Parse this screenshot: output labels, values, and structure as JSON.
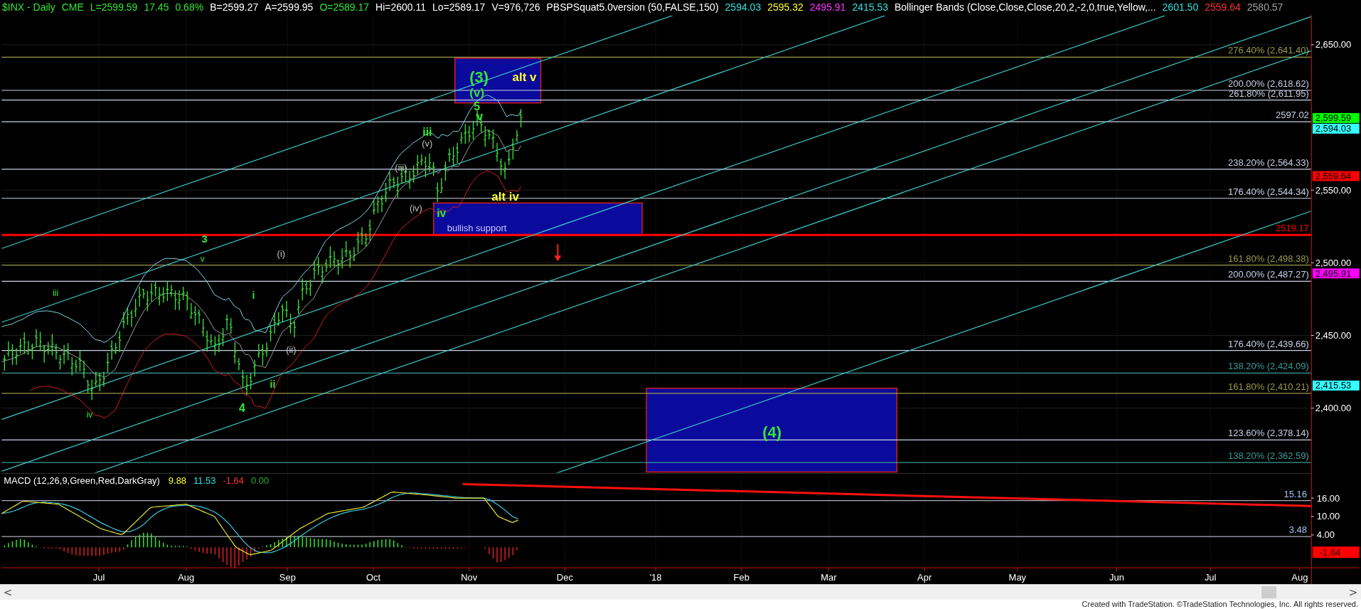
{
  "header": [
    {
      "text": "$INX - Daily",
      "color": "#33e633"
    },
    {
      "text": "CME",
      "color": "#33e633"
    },
    {
      "text": "L=2599.59",
      "color": "#33e633"
    },
    {
      "text": "17.45",
      "color": "#33e633"
    },
    {
      "text": "0.68%",
      "color": "#33e633"
    },
    {
      "text": "B=2599.27",
      "color": "#ffffff"
    },
    {
      "text": "A=2599.95",
      "color": "#ffffff"
    },
    {
      "text": "O=2589.17",
      "color": "#33e633"
    },
    {
      "text": "Hi=2600.11",
      "color": "#ffffff"
    },
    {
      "text": "Lo=2589.17",
      "color": "#ffffff"
    },
    {
      "text": "V=976,726",
      "color": "#ffffff"
    },
    {
      "text": "PBSPSquat5.0version (50,FALSE,150)",
      "color": "#ffffff"
    },
    {
      "text": "2594.03",
      "color": "#33e0e0"
    },
    {
      "text": "2595.32",
      "color": "#ffff33"
    },
    {
      "text": "2495.91",
      "color": "#ff33ff"
    },
    {
      "text": "2415.53",
      "color": "#33e0e0"
    },
    {
      "text": "Bollinger Bands (Close,Close,Close,20,2,-2,0,true,Yellow,...",
      "color": "#ffffff"
    },
    {
      "text": "2601.50",
      "color": "#33e0e0"
    },
    {
      "text": "2559.64",
      "color": "#ff3333"
    },
    {
      "text": "2580.57",
      "color": "#a0a0a0"
    }
  ],
  "price_axis": {
    "ticks": [
      "2,650.00",
      "2,550.00",
      "2,500.00",
      "2,450.00",
      "2,400.00"
    ],
    "badges": [
      {
        "text": "2,599.59",
        "color": "#00ff00"
      },
      {
        "text": "2,594.03",
        "color": "#33ffff"
      },
      {
        "text": "2,559.64",
        "color": "#ff0000"
      },
      {
        "text": "2,495.91",
        "color": "#ff00ff"
      },
      {
        "text": "2,415.53",
        "color": "#33ffff"
      }
    ]
  },
  "levels": [
    {
      "label": "276.40% (2,641.40)",
      "color": "#9c9a4a",
      "kind": "fib"
    },
    {
      "label": "200.00% (2,618.62)",
      "color": "#c8d2e6",
      "kind": "fib"
    },
    {
      "label": "261.80% (2,611.95)",
      "color": "#c8d2e6",
      "kind": "fib"
    },
    {
      "label": "2597.02",
      "color": "#c8d2e6",
      "kind": "price"
    },
    {
      "label": "238.20% (2,564.33)",
      "color": "#c8d2e6",
      "kind": "fib"
    },
    {
      "label": "176.40% (2,544.34)",
      "color": "#c8d2e6",
      "kind": "fib"
    },
    {
      "label": "2519.17",
      "color": "#ff0000",
      "kind": "support"
    },
    {
      "label": "161.80% (2,498.38)",
      "color": "#9c9a4a",
      "kind": "fib"
    },
    {
      "label": "200.00% (2,487.27)",
      "color": "#c8d2e6",
      "kind": "fib"
    },
    {
      "label": "176.40% (2,439.66)",
      "color": "#c8d2e6",
      "kind": "fib"
    },
    {
      "label": "138.20% (2,424.09)",
      "color": "#3c9a96",
      "kind": "fib"
    },
    {
      "label": "161.80% (2,410.21)",
      "color": "#9c9a4a",
      "kind": "fib"
    },
    {
      "label": "123.60% (2,378.14)",
      "color": "#c8d2e6",
      "kind": "fib"
    },
    {
      "label": "138.20% (2,362.59)",
      "color": "#3c9a96",
      "kind": "fib"
    }
  ],
  "wave_labels": [
    {
      "text": "(3)",
      "color": "#33e633"
    },
    {
      "text": "(v)",
      "color": "#33e633"
    },
    {
      "text": "5",
      "color": "#33e633"
    },
    {
      "text": "v",
      "color": "#33e633"
    },
    {
      "text": "alt v",
      "color": "#ffff33"
    },
    {
      "text": "iii",
      "color": "#33e633"
    },
    {
      "text": "(v)",
      "color": "#c0c0c0"
    },
    {
      "text": "(iii)",
      "color": "#c0c0c0"
    },
    {
      "text": "(iv)",
      "color": "#c0c0c0"
    },
    {
      "text": "iv",
      "color": "#33e633"
    },
    {
      "text": "alt iv",
      "color": "#ffff33"
    },
    {
      "text": "3",
      "color": "#33e633"
    },
    {
      "text": "v",
      "color": "#33e633"
    },
    {
      "text": "iii",
      "color": "#33e633"
    },
    {
      "text": "(i)",
      "color": "#c0c0c0"
    },
    {
      "text": "i",
      "color": "#33e633"
    },
    {
      "text": "(ii)",
      "color": "#c0c0c0"
    },
    {
      "text": "ii",
      "color": "#33e633"
    },
    {
      "text": "4",
      "color": "#33e633"
    },
    {
      "text": "iv",
      "color": "#33e633"
    },
    {
      "text": "(4)",
      "color": "#33e633"
    }
  ],
  "support_zone": {
    "label": "bullish support"
  },
  "macd": {
    "title": "MACD (12,26,9,Green,Red,DarkGray)",
    "readings": [
      {
        "text": "9.88",
        "color": "#ffff33"
      },
      {
        "text": "11.53",
        "color": "#33e0e0"
      },
      {
        "text": "-1.64",
        "color": "#ff3333"
      },
      {
        "text": "0.00",
        "color": "#33aa33"
      }
    ],
    "levels": [
      "15.16",
      "3.48"
    ],
    "axis_ticks": [
      "16.00",
      "10.00",
      "4.00"
    ],
    "badge": {
      "text": "-1.64",
      "color": "#ff0000"
    }
  },
  "date_axis": [
    "Jul",
    "Aug",
    "Sep",
    "Oct",
    "Nov",
    "Dec",
    "'18",
    "Feb",
    "Mar",
    "Apr",
    "May",
    "Jun",
    "Jul",
    "Aug"
  ],
  "scrollbar": {
    "left": "<",
    "right": ">"
  },
  "footer": "Created with TradeStation. ©TradeStation Technologies, Inc. All rights reserved."
}
